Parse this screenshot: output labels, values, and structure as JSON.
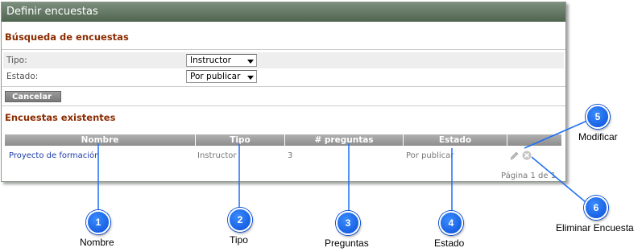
{
  "window": {
    "title": "Definir encuestas"
  },
  "search": {
    "title": "Búsqueda de encuestas",
    "fields": [
      {
        "label": "Tipo:",
        "value": "Instructor"
      },
      {
        "label": "Estado:",
        "value": "Por publicar"
      }
    ],
    "cancel_label": "Cancelar"
  },
  "existing": {
    "title": "Encuestas existentes",
    "columns": [
      "Nombre",
      "Tipo",
      "# preguntas",
      "Estado"
    ],
    "rows": [
      {
        "nombre": "Proyecto de formación",
        "tipo": "Instructor",
        "preguntas": "3",
        "estado": "Por publicar"
      }
    ],
    "pager": "Página 1 de 1"
  },
  "icons": {
    "edit": "pencil-icon",
    "delete": "delete-x-icon"
  },
  "callouts": [
    {
      "number": "1",
      "label": "Nombre"
    },
    {
      "number": "2",
      "label": "Tipo"
    },
    {
      "number": "3",
      "label": "Preguntas"
    },
    {
      "number": "4",
      "label": "Estado"
    },
    {
      "number": "5",
      "label": "Modificar"
    },
    {
      "number": "6",
      "label": "Eliminar Encuesta"
    }
  ],
  "colors": {
    "titlebar": "#4f6550",
    "section_title": "#8b2b00",
    "link": "#1a3aa8",
    "callout": "#0a4fd8"
  }
}
